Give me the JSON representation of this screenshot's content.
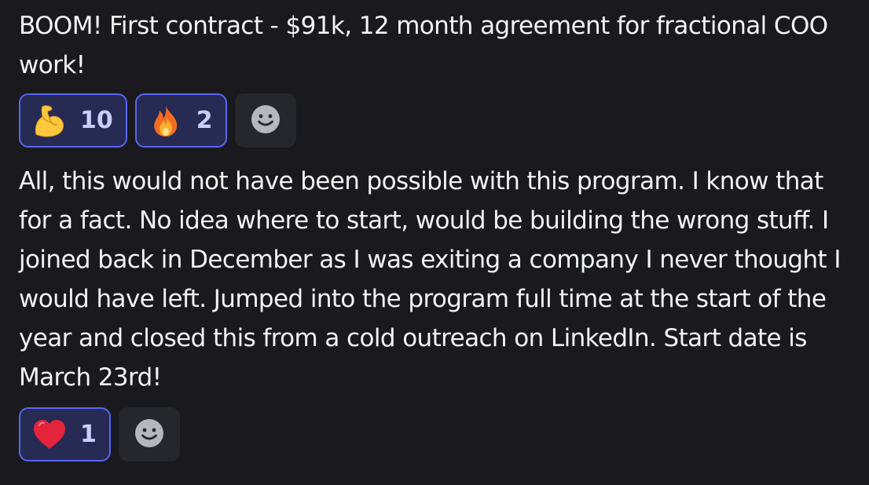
{
  "messages": [
    {
      "text": "BOOM! First contract - $91k, 12 month agreement for fractional COO work!",
      "reactions": [
        {
          "emoji": "flexed-biceps",
          "count": "10"
        },
        {
          "emoji": "fire",
          "count": "2"
        }
      ],
      "add_reaction_icon": "smiley-face-icon"
    },
    {
      "text": "All, this would not have been possible with this program. I know that for a fact. No idea where to start, would be building the wrong stuff. I joined back in December as I was exiting a company I never thought I would have left. Jumped into the program full time at the start of the year and closed this from a cold outreach on LinkedIn. Start date is March 23rd!",
      "reactions": [
        {
          "emoji": "red-heart",
          "count": "1"
        }
      ],
      "add_reaction_icon": "smiley-face-icon"
    }
  ],
  "colors": {
    "background": "#1a1a1e",
    "text": "#f2f3f5",
    "reaction_active_bg": "#272a52",
    "reaction_active_border": "#5865f2",
    "reaction_count": "#c9cdfb",
    "add_reaction_bg": "#26272c"
  }
}
